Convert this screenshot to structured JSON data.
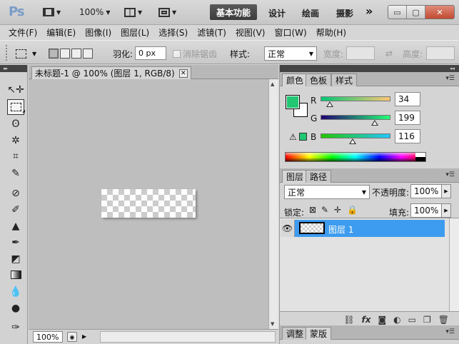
{
  "app": {
    "logo": "Ps",
    "zoom": "100%",
    "workspaces": [
      "基本功能",
      "设计",
      "绘画",
      "摄影"
    ],
    "more": "»",
    "window_controls": {
      "minimize": "▭",
      "restore": "▢",
      "close": "✕"
    }
  },
  "menu": [
    "文件(F)",
    "编辑(E)",
    "图像(I)",
    "图层(L)",
    "选择(S)",
    "滤镜(T)",
    "视图(V)",
    "窗口(W)",
    "帮助(H)"
  ],
  "options": {
    "feather_label": "羽化:",
    "feather_value": "0 px",
    "antialias_label": "消除锯齿",
    "style_label": "样式:",
    "style_value": "正常",
    "width_label": "宽度:",
    "height_label": "高度:",
    "swap_icon": "⇄"
  },
  "document": {
    "tab_title": "未标题-1 @ 100% (图层 1, RGB/8)",
    "close_glyph": "✕",
    "status_zoom": "100%"
  },
  "color_panel": {
    "tabs": [
      "颜色",
      "色板",
      "样式"
    ],
    "foreground_color": "#22c774",
    "channels": [
      {
        "label": "R",
        "value": "34",
        "gradient": "linear-gradient(to right,#00c774,#ffc774)",
        "fraction": 0.133
      },
      {
        "label": "G",
        "value": "199",
        "gradient": "linear-gradient(to right,#220074,#22ff74)",
        "fraction": 0.78
      },
      {
        "label": "B",
        "value": "116",
        "gradient": "linear-gradient(to right,#22c700,#22c7ff)",
        "fraction": 0.455
      }
    ],
    "warning_icon": "⚠"
  },
  "layers_panel": {
    "tabs": [
      "图层",
      "路径"
    ],
    "blend_mode": "正常",
    "opacity_label": "不透明度:",
    "opacity_value": "100%",
    "lock_label": "锁定:",
    "fill_label": "填充:",
    "fill_value": "100%",
    "layers": [
      {
        "name": "图层 1",
        "selected": true
      }
    ],
    "footer_icons": [
      "⛓",
      "fx",
      "◙",
      "◐",
      "▭",
      "❐",
      "🗑"
    ]
  },
  "bottom_panel": {
    "tabs": [
      "调整",
      "蒙版"
    ]
  },
  "tools": [
    "↖✛",
    "⬚",
    "ʘ",
    "✲",
    "⌗",
    "✎",
    "⊘",
    "✐",
    "▲",
    "✒",
    "◩",
    "▬",
    "💧",
    "●",
    "✑"
  ]
}
